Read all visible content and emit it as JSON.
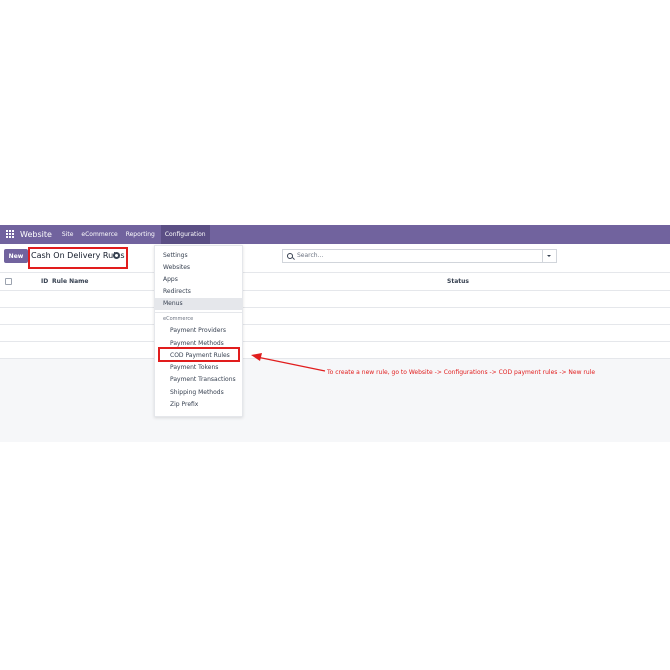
{
  "navbar": {
    "brand": "Website",
    "items": [
      "Site",
      "eCommerce",
      "Reporting"
    ],
    "active_item": "Configuration"
  },
  "control": {
    "new_label": "New",
    "breadcrumb": "Cash On Delivery Rules",
    "search_placeholder": "Search..."
  },
  "table": {
    "columns": {
      "id": "ID",
      "name": "Rule Name",
      "status": "Status"
    }
  },
  "menu": {
    "items": [
      "Settings",
      "Websites",
      "Apps",
      "Redirects",
      "Menus"
    ],
    "section_header": "eCommerce",
    "section_items": [
      "Payment Providers",
      "Payment Methods",
      "COD Payment Rules",
      "Payment Tokens",
      "Payment Transactions",
      "Shipping Methods",
      "Zip Prefix"
    ]
  },
  "annotation": {
    "text": "To create a new rule, go to Website -> Configurations -> COD payment rules -> New rule",
    "color": "#e11d1d"
  },
  "colors": {
    "brand": "#71639e",
    "highlight": "#e11d1d"
  }
}
